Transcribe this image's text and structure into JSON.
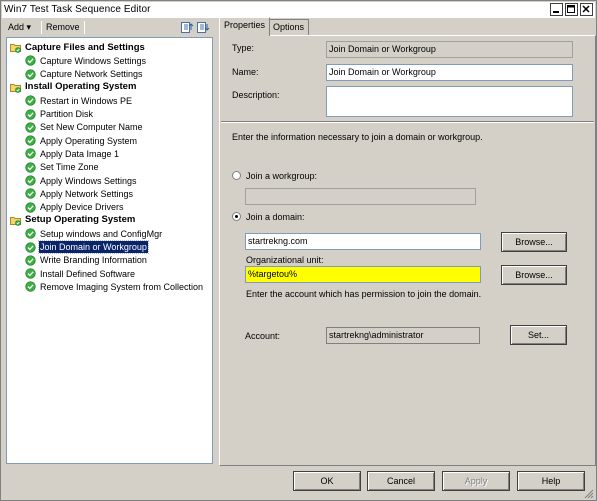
{
  "window": {
    "title": "Win7 Test Task Sequence Editor"
  },
  "toolbar": {
    "add_label": "Add",
    "add_arrow": "▾",
    "remove_label": "Remove"
  },
  "tree": {
    "items": [
      {
        "label": "Capture Files and Settings",
        "type": "group"
      },
      {
        "label": "Capture Windows Settings",
        "type": "step"
      },
      {
        "label": "Capture Network Settings",
        "type": "step"
      },
      {
        "label": "Install Operating System",
        "type": "group"
      },
      {
        "label": "Restart in Windows PE",
        "type": "step"
      },
      {
        "label": "Partition Disk",
        "type": "step"
      },
      {
        "label": "Set New Computer Name",
        "type": "step"
      },
      {
        "label": "Apply Operating System",
        "type": "step"
      },
      {
        "label": "Apply Data Image 1",
        "type": "step"
      },
      {
        "label": "Set Time Zone",
        "type": "step"
      },
      {
        "label": "Apply Windows Settings",
        "type": "step"
      },
      {
        "label": "Apply Network Settings",
        "type": "step"
      },
      {
        "label": "Apply Device Drivers",
        "type": "step"
      },
      {
        "label": "Setup Operating System",
        "type": "group"
      },
      {
        "label": "Setup windows and ConfigMgr",
        "type": "step"
      },
      {
        "label": "Join Domain or Workgroup",
        "type": "step",
        "selected": true
      },
      {
        "label": "Write Branding Information",
        "type": "step"
      },
      {
        "label": "Install Defined Software",
        "type": "step"
      },
      {
        "label": "Remove Imaging System from Collection",
        "type": "step"
      }
    ]
  },
  "tabs": {
    "properties": "Properties",
    "options": "Options"
  },
  "properties": {
    "type_label": "Type:",
    "type_value": "Join Domain or Workgroup",
    "name_label": "Name:",
    "name_value": "Join Domain or Workgroup",
    "description_label": "Description:",
    "description_value": "",
    "info_text": "Enter the information necessary to join a domain or workgroup.",
    "workgroup_radio": "Join a workgroup:",
    "workgroup_value": "",
    "domain_radio": "Join a domain:",
    "domain_value": "startrekng.com",
    "browse_domain": "Browse...",
    "ou_label": "Organizational unit:",
    "ou_value": "%targetou%",
    "browse_ou": "Browse...",
    "account_info": "Enter the account which has permission to join the domain.",
    "account_label": "Account:",
    "account_value": "startrekng\\administrator",
    "set_button": "Set..."
  },
  "footer": {
    "ok": "OK",
    "cancel": "Cancel",
    "apply": "Apply",
    "help": "Help"
  },
  "colors": {
    "selection": "#0a246a",
    "ou_highlight": "#ffff00",
    "step_icon": "#3cb043"
  }
}
